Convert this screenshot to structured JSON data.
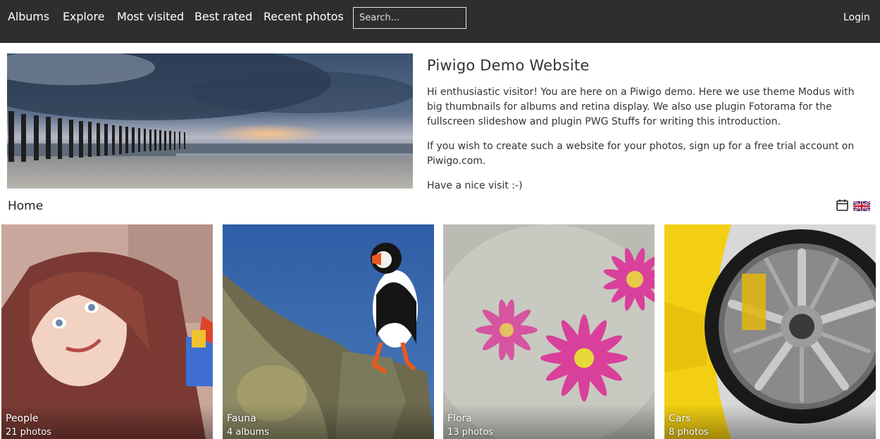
{
  "nav": {
    "items": [
      {
        "label": "Albums"
      },
      {
        "label": "Explore"
      },
      {
        "label": "Most visited"
      },
      {
        "label": "Best rated"
      },
      {
        "label": "Recent photos"
      }
    ],
    "search_placeholder": "Search...",
    "login_label": "Login"
  },
  "intro": {
    "title": "Piwigo Demo Website",
    "paragraphs": [
      "Hi enthusiastic visitor! You are here on a Piwigo demo. Here we use theme Modus with big thumbnails for albums and retina display. We also use plugin Fotorama for the fullscreen slideshow and plugin PWG Stuffs for writing this introduction.",
      "If you wish to create such a website for your photos, sign up for a free trial account on Piwigo.com.",
      "Have a nice visit :-)"
    ]
  },
  "breadcrumb": "Home",
  "icons": {
    "calendar": "calendar-icon",
    "language": "uk-flag-icon"
  },
  "albums": [
    {
      "name": "People",
      "count": "21 photos"
    },
    {
      "name": "Fauna",
      "count": "4 albums"
    },
    {
      "name": "Flora",
      "count": "13 photos"
    },
    {
      "name": "Cars",
      "count": "8 photos"
    }
  ],
  "colors": {
    "navbar": "#2e2e2e",
    "nav_text": "#ffffff",
    "page_bg": "#ffffff"
  }
}
